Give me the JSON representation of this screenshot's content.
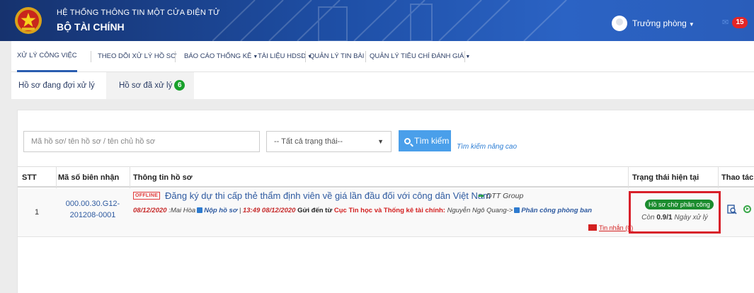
{
  "header": {
    "subtitle": "HỆ THỐNG THÔNG TIN MỘT CỬA ĐIỆN TỬ",
    "title": "BỘ TÀI CHÍNH",
    "user_name": "Trưởng phòng",
    "notification_count": "15"
  },
  "menu": {
    "items": [
      {
        "label": "XỬ LÝ CÔNG VIỆC"
      },
      {
        "label": "THEO DÕI XỬ LÝ HỒ SƠ"
      },
      {
        "label": "BÁO CÁO THỐNG KÊ"
      },
      {
        "label": "TÀI LIỆU HDSD"
      },
      {
        "label": "QUẢN LÝ TIN BÀI"
      },
      {
        "label": "QUẢN LÝ TIÊU CHÍ ĐÁNH GIÁ"
      }
    ]
  },
  "subtabs": {
    "pending_label": "Hồ sơ đang đợi xử lý",
    "processed_label": "Hồ sơ đã xử lý",
    "processed_count": "6"
  },
  "search": {
    "placeholder": "Mã hồ sơ/ tên hồ sơ / tên chủ hồ sơ",
    "status_selected": "-- Tất cả trạng thái--",
    "button_label": "Tìm kiếm",
    "advanced_link": "Tìm kiếm nâng cao"
  },
  "table": {
    "headers": {
      "stt": "STT",
      "code": "Mã số biên nhận",
      "info": "Thông tin hồ sơ",
      "status": "Trạng thái hiện tại",
      "actions": "Thao tác"
    },
    "rows": [
      {
        "stt": "1",
        "code_line1": "000.00.30.G12-",
        "code_line2": "201208-0001",
        "offline_tag": "OFFLINE",
        "title": "Đăng ký dự thi cấp thẻ thẩm định viên về giá lần đầu đối với công dân Việt Nam",
        "group": "DTT Group",
        "date1": "08/12/2020",
        "person1": ":Mai Hòa",
        "action1": "Nộp hồ sơ",
        "time2": "13:49 08/12/2020",
        "sent_to": "Gửi đến từ",
        "department": "Cục Tin học và Thống kê tài chính:",
        "person2": "Nguyễn Ngô Quang->",
        "action2": "Phân công phòng ban",
        "messages": "Tin nhắn (0)",
        "status_pill": "Hồ sơ chờ phân công",
        "days_prefix": "Còn",
        "days_value": "0.9/1",
        "days_suffix": "Ngày xử lý"
      }
    ]
  },
  "colors": {
    "header_blue": "#1e4fa6",
    "accent_blue": "#4a9fea",
    "status_green": "#1b8c2e",
    "alert_red": "#d8202a"
  }
}
